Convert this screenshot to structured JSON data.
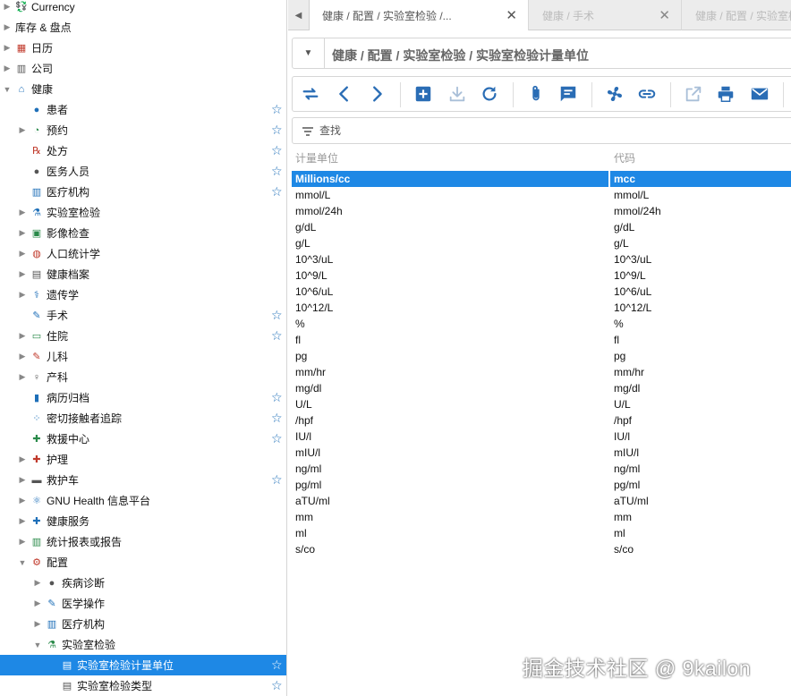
{
  "sidebar": {
    "items": [
      {
        "label": "Currency",
        "icon": "currency-icon",
        "expander": "collapsed",
        "star": false
      },
      {
        "label": "库存 & 盘点",
        "icon": "",
        "expander": "collapsed",
        "star": false
      },
      {
        "label": "日历",
        "icon": "calendar-icon",
        "expander": "collapsed",
        "star": false
      },
      {
        "label": "公司",
        "icon": "company-icon",
        "expander": "collapsed",
        "star": false
      },
      {
        "label": "健康",
        "icon": "health-icon",
        "expander": "expanded",
        "star": false
      },
      {
        "label": "患者",
        "icon": "patient-icon",
        "expander": "none",
        "star": true
      },
      {
        "label": "预约",
        "icon": "appointment-icon",
        "expander": "collapsed",
        "star": true
      },
      {
        "label": "处方",
        "icon": "prescription-icon",
        "expander": "none",
        "star": true
      },
      {
        "label": "医务人员",
        "icon": "health-professional-icon",
        "expander": "none",
        "star": true
      },
      {
        "label": "医疗机构",
        "icon": "institution-icon",
        "expander": "none",
        "star": true
      },
      {
        "label": "实验室检验",
        "icon": "lab-icon",
        "expander": "collapsed",
        "star": false
      },
      {
        "label": "影像检查",
        "icon": "imaging-icon",
        "expander": "collapsed",
        "star": false
      },
      {
        "label": "人口统计学",
        "icon": "demographics-icon",
        "expander": "collapsed",
        "star": false
      },
      {
        "label": "健康档案",
        "icon": "health-record-icon",
        "expander": "collapsed",
        "star": false
      },
      {
        "label": "遗传学",
        "icon": "genetics-icon",
        "expander": "collapsed",
        "star": false
      },
      {
        "label": "手术",
        "icon": "surgery-icon",
        "expander": "none",
        "star": true
      },
      {
        "label": "住院",
        "icon": "inpatient-icon",
        "expander": "collapsed",
        "star": true
      },
      {
        "label": "儿科",
        "icon": "pediatrics-icon",
        "expander": "collapsed",
        "star": false
      },
      {
        "label": "产科",
        "icon": "obstetrics-icon",
        "expander": "collapsed",
        "star": false
      },
      {
        "label": "病历归档",
        "icon": "archive-icon",
        "expander": "none",
        "star": true
      },
      {
        "label": "密切接触者追踪",
        "icon": "contact-tracing-icon",
        "expander": "none",
        "star": true
      },
      {
        "label": "救援中心",
        "icon": "rescue-icon",
        "expander": "none",
        "star": true
      },
      {
        "label": "护理",
        "icon": "nursing-icon",
        "expander": "collapsed",
        "star": false
      },
      {
        "label": "救护车",
        "icon": "ambulance-icon",
        "expander": "collapsed",
        "star": true
      },
      {
        "label": "GNU Health 信息平台",
        "icon": "federation-icon",
        "expander": "collapsed",
        "star": false
      },
      {
        "label": "健康服务",
        "icon": "health-services-icon",
        "expander": "collapsed",
        "star": false
      },
      {
        "label": "统计报表或报告",
        "icon": "report-icon",
        "expander": "collapsed",
        "star": false
      },
      {
        "label": "配置",
        "icon": "config-icon",
        "expander": "expanded",
        "star": false
      },
      {
        "label": "疾病诊断",
        "icon": "disease-icon",
        "expander": "collapsed",
        "star": false
      },
      {
        "label": "医学操作",
        "icon": "procedure-icon",
        "expander": "collapsed",
        "star": false
      },
      {
        "label": "医疗机构",
        "icon": "institution-icon",
        "expander": "collapsed",
        "star": false
      },
      {
        "label": "实验室检验",
        "icon": "lab-icon",
        "expander": "expanded",
        "star": false
      },
      {
        "label": "实验室检验计量单位",
        "icon": "document-icon",
        "expander": "none",
        "star": true,
        "selected": true
      },
      {
        "label": "实验室检验类型",
        "icon": "document-icon",
        "expander": "none",
        "star": true
      }
    ]
  },
  "tabs": [
    {
      "label": "健康 / 配置 / 实验室检验 /...",
      "active": true
    },
    {
      "label": "健康 / 手术",
      "active": false
    },
    {
      "label": "健康 / 配置 / 实验室检",
      "active": false
    }
  ],
  "breadcrumb": "健康 / 配置 / 实验室检验 / 实验室检验计量单位",
  "filter": {
    "placeholder": "查找"
  },
  "table": {
    "headers": [
      "计量单位",
      "代码"
    ],
    "rows": [
      [
        "Millions/cc",
        "mcc"
      ],
      [
        "mmol/L",
        "mmol/L"
      ],
      [
        "mmol/24h",
        "mmol/24h"
      ],
      [
        "g/dL",
        "g/dL"
      ],
      [
        "g/L",
        "g/L"
      ],
      [
        "10^3/uL",
        "10^3/uL"
      ],
      [
        "10^9/L",
        "10^9/L"
      ],
      [
        "10^6/uL",
        "10^6/uL"
      ],
      [
        "10^12/L",
        "10^12/L"
      ],
      [
        "%",
        "%"
      ],
      [
        "fl",
        "fl"
      ],
      [
        "pg",
        "pg"
      ],
      [
        "mm/hr",
        "mm/hr"
      ],
      [
        "mg/dl",
        "mg/dl"
      ],
      [
        "U/L",
        "U/L"
      ],
      [
        "/hpf",
        "/hpf"
      ],
      [
        "IU/l",
        "IU/l"
      ],
      [
        "mIU/l",
        "mIU/l"
      ],
      [
        "ng/ml",
        "ng/ml"
      ],
      [
        "pg/ml",
        "pg/ml"
      ],
      [
        "aTU/ml",
        "aTU/ml"
      ],
      [
        "mm",
        "mm"
      ],
      [
        "ml",
        "ml"
      ],
      [
        "s/co",
        "s/co"
      ]
    ],
    "selected_row": 0
  },
  "watermark": "掘金技术社区 @ 9kailon",
  "colors": {
    "accent": "#1e88e5",
    "icon_blue": "#1e6fb8",
    "toolbar_blue": "#2a6db5"
  }
}
